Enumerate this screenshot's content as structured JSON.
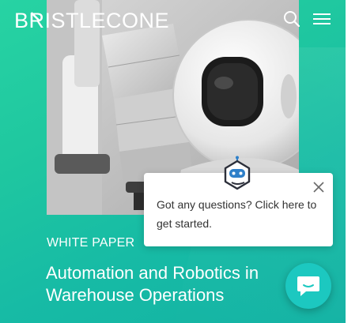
{
  "header": {
    "brand": "BRISTLECONE",
    "search_icon": "search-icon",
    "menu_icon": "hamburger-menu-icon"
  },
  "article": {
    "category": "WHITE PAPER",
    "title": "Automation and Robotics in Warehouse Operations",
    "image_icon": "robot-photo"
  },
  "chat": {
    "message": "Got any questions? Click here to get started.",
    "close_icon": "close-icon",
    "avatar_icon": "bot-avatar-icon",
    "launcher_icon": "chat-icon"
  },
  "colors": {
    "hero_start": "#27d3a3",
    "hero_end": "#13b2a4",
    "chat_accent": "#1cc8c0",
    "text_on_hero": "#ffffff"
  }
}
